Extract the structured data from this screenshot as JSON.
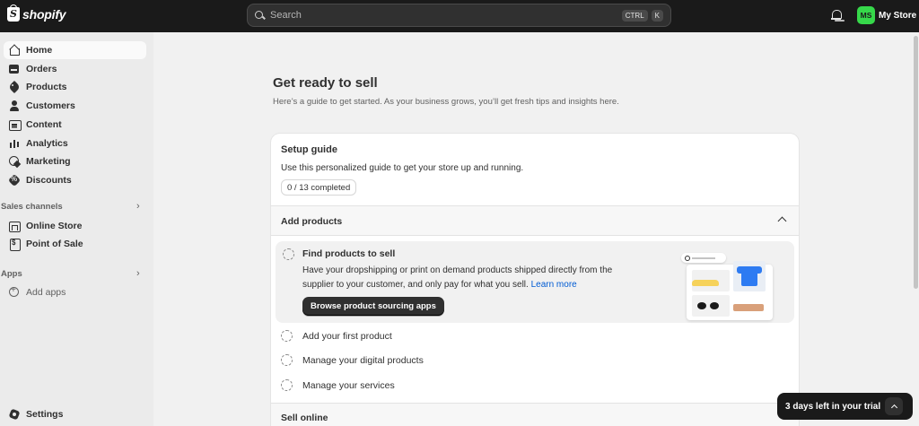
{
  "topbar": {
    "brand": "shopify",
    "search_placeholder": "Search",
    "shortcut_keys": [
      "CTRL",
      "K"
    ],
    "store_initials": "MS",
    "store_name": "My Store",
    "avatar_color": "#36d84a"
  },
  "sidebar": {
    "main_items": [
      {
        "label": "Home",
        "icon": "home-icon",
        "active": true
      },
      {
        "label": "Orders",
        "icon": "orders-icon"
      },
      {
        "label": "Products",
        "icon": "tag-icon"
      },
      {
        "label": "Customers",
        "icon": "person-icon"
      },
      {
        "label": "Content",
        "icon": "content-icon"
      },
      {
        "label": "Analytics",
        "icon": "bar-chart-icon"
      },
      {
        "label": "Marketing",
        "icon": "target-icon"
      },
      {
        "label": "Discounts",
        "icon": "discount-icon"
      }
    ],
    "sales_channels_label": "Sales channels",
    "sales_channels": [
      {
        "label": "Online Store",
        "icon": "store-icon"
      },
      {
        "label": "Point of Sale",
        "icon": "pos-icon"
      }
    ],
    "apps_label": "Apps",
    "add_apps_label": "Add apps",
    "settings_label": "Settings"
  },
  "main": {
    "title": "Get ready to sell",
    "subtitle": "Here’s a guide to get started. As your business grows, you’ll get fresh tips and insights here.",
    "setup_guide": {
      "title": "Setup guide",
      "description": "Use this personalized guide to get your store up and running.",
      "progress": "0 / 13 completed",
      "section_title": "Add products",
      "active_task": {
        "title": "Find products to sell",
        "description": "Have your dropshipping or print on demand products shipped directly from the supplier to your customer, and only pay for what you sell.",
        "link": "Learn more",
        "button": "Browse product sourcing apps"
      },
      "tasks": [
        {
          "title": "Add your first product"
        },
        {
          "title": "Manage your digital products"
        },
        {
          "title": "Manage your services"
        }
      ],
      "next_section_title": "Sell online"
    }
  },
  "trial": {
    "label": "3 days left in your trial"
  },
  "colors": {
    "topbar": "#1a1a1a",
    "link": "#005bd3",
    "primary_button": "#303030"
  }
}
